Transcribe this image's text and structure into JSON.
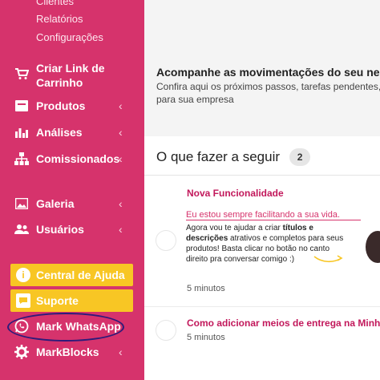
{
  "sidebar": {
    "sub_items": [
      "Clientes",
      "Relatórios",
      "Configurações"
    ],
    "cart_link": "Criar Link de Carrinho",
    "items": [
      {
        "label": "Produtos",
        "icon": "products-icon"
      },
      {
        "label": "Análises",
        "icon": "chart-icon"
      },
      {
        "label": "Comissionados",
        "icon": "hierarchy-icon"
      },
      {
        "label": "Galeria",
        "icon": "gallery-icon"
      },
      {
        "label": "Usuários",
        "icon": "users-icon"
      }
    ],
    "help_center": "Central de Ajuda",
    "support": "Suporte",
    "whatsapp": "Mark WhatsApp",
    "markblocks": "MarkBlocks"
  },
  "header": {
    "title": "Acompanhe as movimentações do seu negóc",
    "subtitle": "Confira aqui os próximos passos, tarefas pendentes, dic para sua empresa"
  },
  "tasks": {
    "heading": "O que fazer a seguir",
    "count": "2",
    "items": [
      {
        "title": "Nova Funcionalidade",
        "promo_heading": "Eu estou sempre facilitando a sua vida.",
        "promo_text_1": "Agora vou te ajudar a criar ",
        "promo_bold_1": "títulos e descrições",
        "promo_text_2": " atrativos e completos para seus produtos! Basta clicar no botão no canto direito pra conversar comigo :)",
        "meta": "5 minutos"
      },
      {
        "title": "Como adicionar meios de entrega na Minha L",
        "meta": "5 minutos"
      }
    ]
  },
  "colors": {
    "sidebar": "#d6336c",
    "yellow": "#f8c624",
    "accent": "#c2185b"
  }
}
